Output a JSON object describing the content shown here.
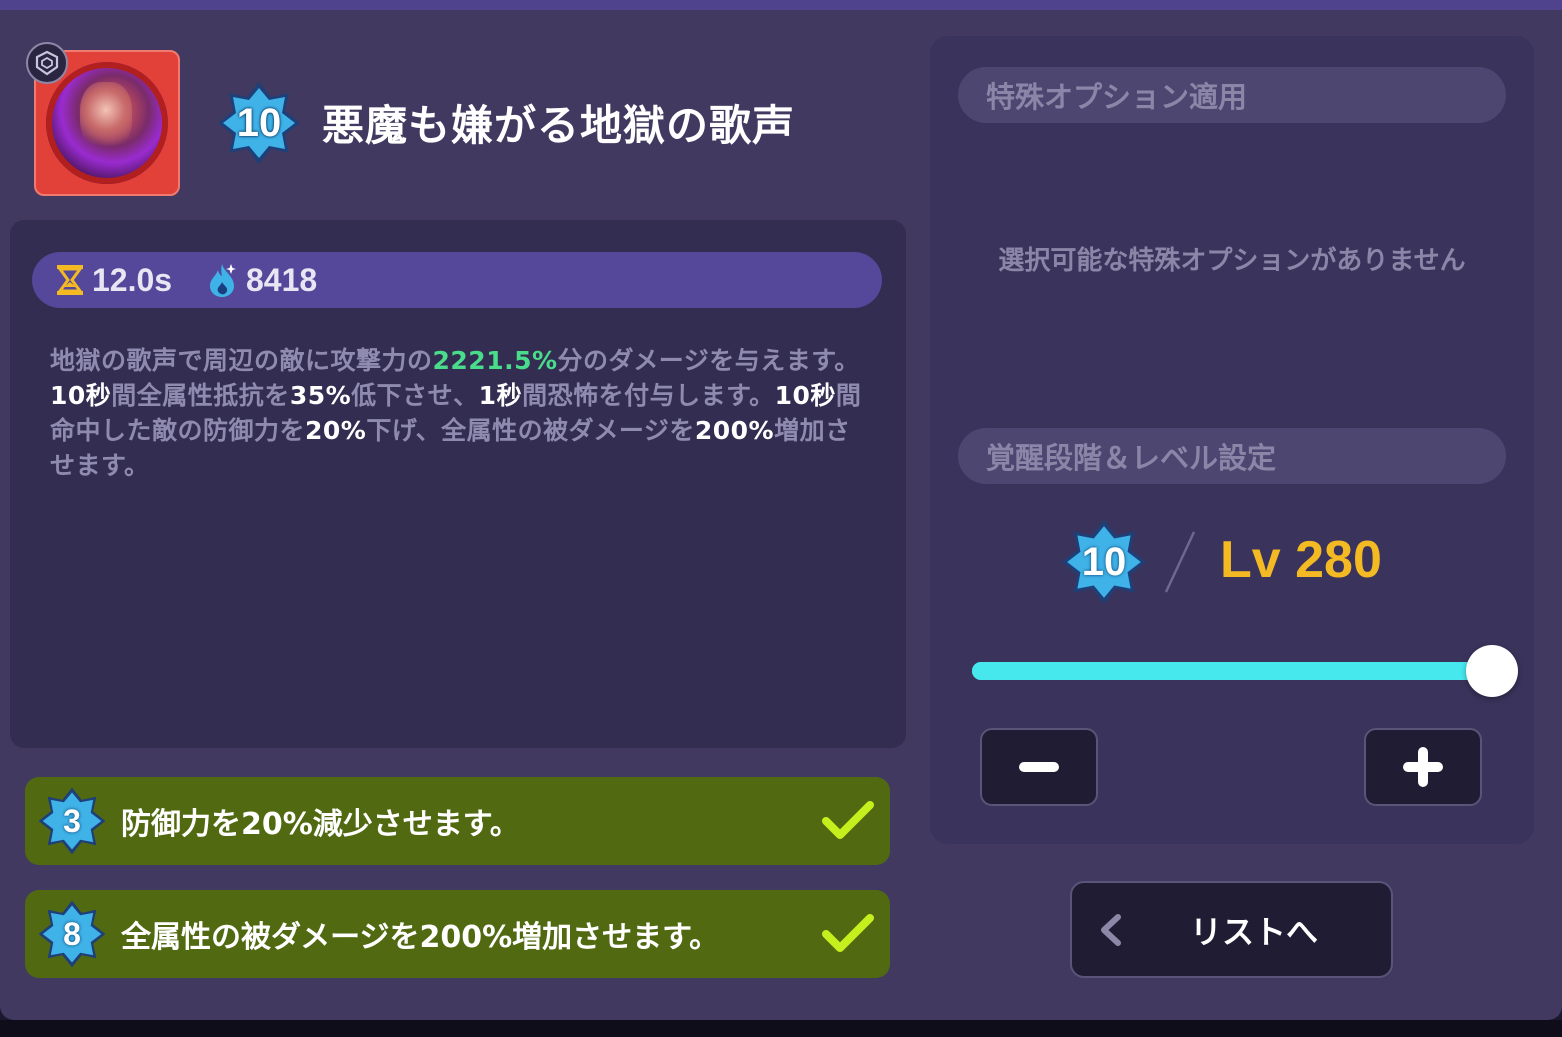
{
  "skill": {
    "name": "悪魔も嫌がる地獄の歌声",
    "awakening_level": "10",
    "cooldown": "12.0s",
    "power": "8418",
    "description": {
      "p1": "地獄の歌声で周辺の敵に攻撃力の",
      "dmg": "2221.5%",
      "p2": "分のダメージを与えます。",
      "dur1": "10秒",
      "p3": "間全属性抵抗を",
      "res": "35%",
      "p4": "低下させ、",
      "dur2": "1秒",
      "p5": "間恐怖を付与します。",
      "dur3": "10秒",
      "p6": "間命中した敵の防御力を",
      "def": "20%",
      "p7": "下げ、全属性の被ダメージを",
      "taken": "200%",
      "p8": "増加させます。"
    }
  },
  "passives": [
    {
      "level": "3",
      "text": "防御力を20%減少させます。",
      "unlocked": true
    },
    {
      "level": "8",
      "text": "全属性の被ダメージを200%増加させます。",
      "unlocked": true
    }
  ],
  "special_options": {
    "header": "特殊オプション適用",
    "empty_message": "選択可能な特殊オプションがありません"
  },
  "level_settings": {
    "header": "覚醒段階＆レベル設定",
    "awakening": "10",
    "level_text": "Lv 280",
    "slider_fraction": 1.0
  },
  "back_button": {
    "label": "リストへ"
  },
  "colors": {
    "panel": "#413960",
    "accent_cyan": "#46e8ee",
    "level_gold": "#f3ba23",
    "passive_green": "#516a12",
    "check_lime": "#c6f01d",
    "damage_green": "#49dc8a"
  }
}
